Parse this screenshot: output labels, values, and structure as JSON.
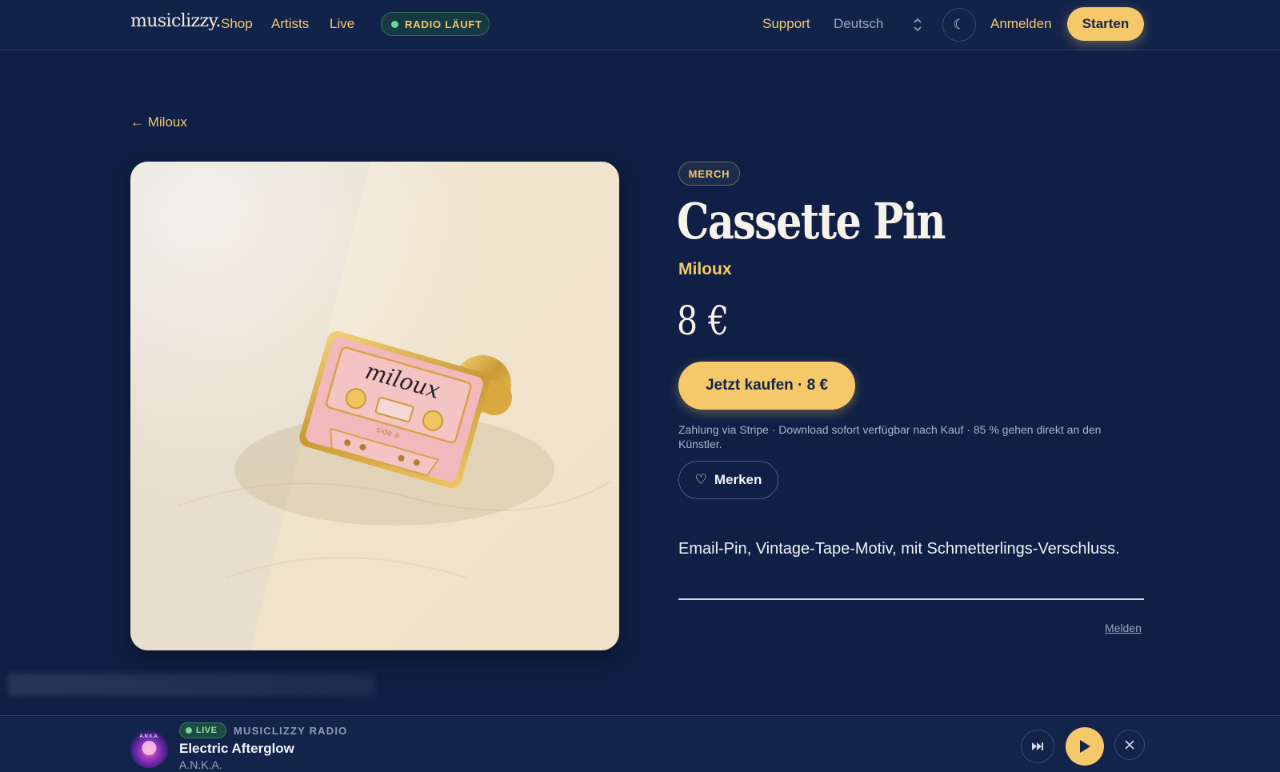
{
  "header": {
    "logo": "musiclizzy.",
    "nav": [
      "Shop",
      "Artists",
      "Live"
    ],
    "radio_status": "RADIO LÄUFT",
    "support": "Support",
    "language": "Deutsch",
    "theme_icon": "☾",
    "login": "Anmelden",
    "start": "Starten"
  },
  "breadcrumb": {
    "back_label": "← Miloux"
  },
  "product": {
    "category": "MERCH",
    "title": "Cassette Pin",
    "artist": "Miloux",
    "price": "8 €",
    "buy_label": "Jetzt kaufen · 8 €",
    "payment_note": "Zahlung via Stripe · Download sofort verfügbar nach Kauf · 85 % gehen direkt an den Künstler.",
    "save_icon": "♡",
    "save_label": "Merken",
    "description": "Email-Pin, Vintage-Tape-Motiv, mit Schmetterlings-Verschluss.",
    "report_label": "Melden",
    "image_text": {
      "brand": "miloux",
      "side": "side a"
    }
  },
  "player": {
    "live_label": "LIVE",
    "station": "MUSICLIZZY RADIO",
    "track": "Electric Afterglow",
    "artist": "A.N.K.A.",
    "cover_text": "A.N.K.A."
  },
  "colors": {
    "background": "#0f1f45",
    "accent": "#f5c96a",
    "live_green": "#6ed79a"
  }
}
